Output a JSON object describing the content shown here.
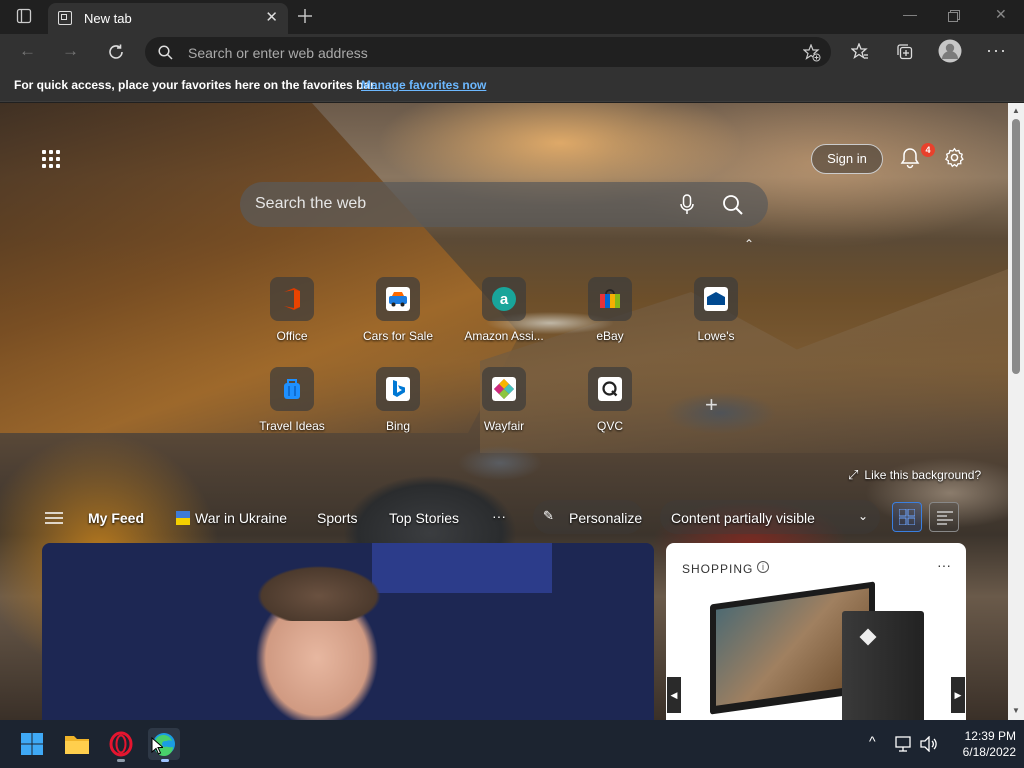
{
  "browser": {
    "tab": {
      "title": "New tab"
    },
    "address_placeholder": "Search or enter web address",
    "favorites_bar": {
      "message": "For quick access, place your favorites here on the favorites bar.",
      "link": "Manage favorites now"
    }
  },
  "newtab": {
    "sign_in": "Sign in",
    "notification_count": "4",
    "search_placeholder": "Search the web",
    "quick_links": [
      {
        "label": "Office",
        "icon": "office-icon",
        "color": "#d83b01"
      },
      {
        "label": "Cars for Sale",
        "icon": "cars-icon",
        "color": "#1c7ce0"
      },
      {
        "label": "Amazon Assi...",
        "icon": "amazon-icon",
        "color": "#19a59a"
      },
      {
        "label": "eBay",
        "icon": "ebay-icon",
        "color": "#e53238"
      },
      {
        "label": "Lowe's",
        "icon": "lowes-icon",
        "color": "#004990"
      },
      {
        "label": "Travel Ideas",
        "icon": "travel-icon",
        "color": "#1e90ff"
      },
      {
        "label": "Bing",
        "icon": "bing-icon",
        "color": "#0078d4"
      },
      {
        "label": "Wayfair",
        "icon": "wayfair-icon",
        "color": "#7f187f"
      },
      {
        "label": "QVC",
        "icon": "qvc-icon",
        "color": "#222222"
      }
    ],
    "like_background": "Like this background?",
    "feed_nav": {
      "my_feed": "My Feed",
      "war_in_ukraine": "War in Ukraine",
      "sports": "Sports",
      "top_stories": "Top Stories",
      "more": "···",
      "personalize": "Personalize",
      "content_visibility": "Content partially visible"
    },
    "shopping": {
      "header": "SHOPPING",
      "info": "i",
      "more": "···"
    }
  },
  "taskbar": {
    "time": "12:39 PM",
    "date": "6/18/2022"
  },
  "colors": {
    "accent": "#6cb8ff",
    "badge": "#e8412c"
  }
}
